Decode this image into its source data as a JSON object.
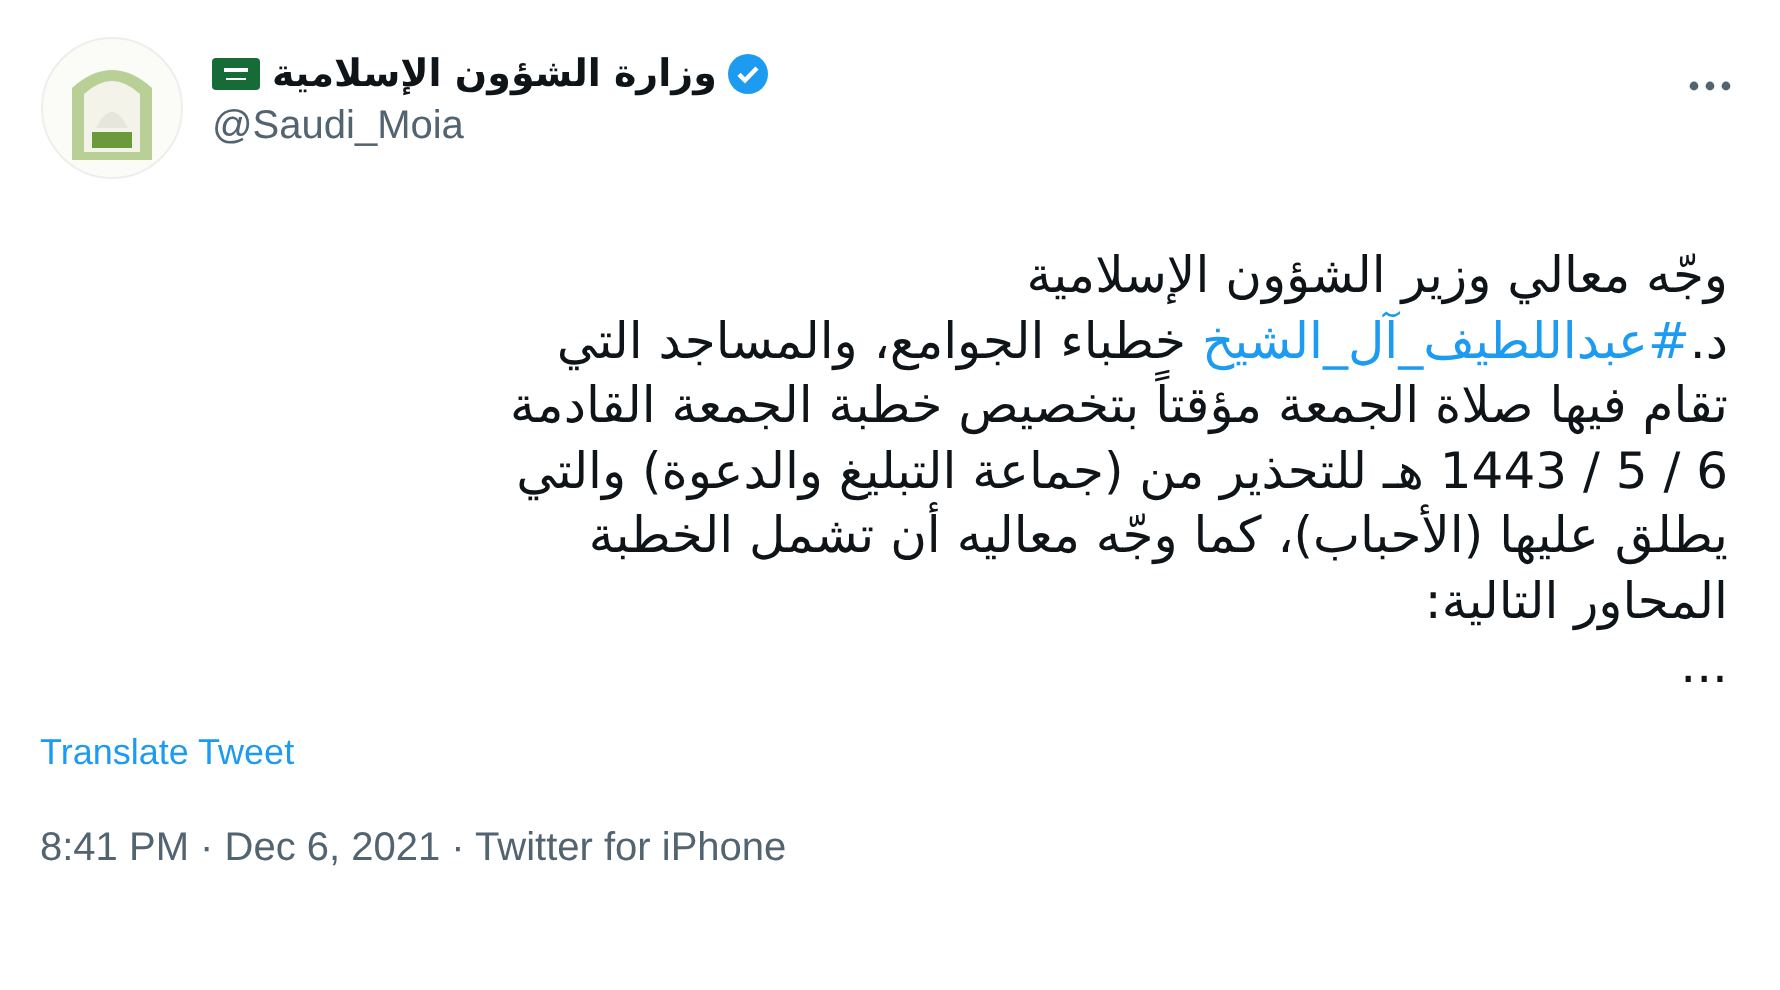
{
  "author": {
    "name": "وزارة الشؤون الإسلامية",
    "handle": "@Saudi_Moia",
    "verified": true
  },
  "body": [
    {
      "text": "وجّه معالي وزير الشؤون الإسلامية"
    },
    {
      "text": "د.",
      "hashtag": "#عبداللطيف_آل_الشيخ",
      "after": " خطباء الجوامع، والمساجد التي"
    },
    {
      "text": "تقام فيها صلاة الجمعة مؤقتاً بتخصيص خطبة الجمعة القادمة"
    },
    {
      "text": "6 / 5 / 1443 هـ للتحذير من (جماعة التبليغ والدعوة) والتي"
    },
    {
      "text": "يطلق عليها (الأحباب)، كما وجّه معاليه أن تشمل الخطبة"
    },
    {
      "text": "المحاور التالية:"
    },
    {
      "text": "..."
    }
  ],
  "translate_link": "Translate Tweet",
  "meta": "8:41 PM · Dec 6, 2021 · Twitter for iPhone"
}
